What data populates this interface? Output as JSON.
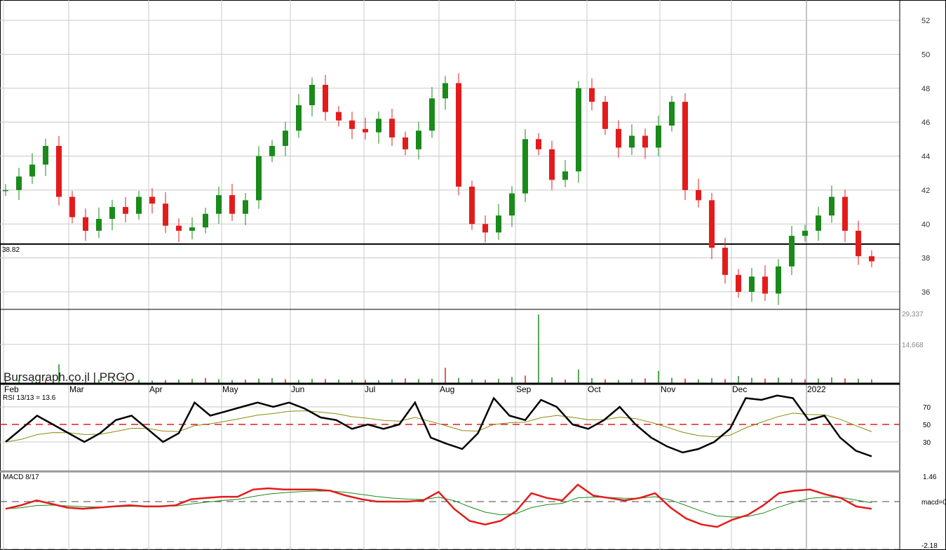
{
  "chart_data": {
    "type": "candlestick",
    "brand": "Bursagraph.co.il | PRGO",
    "ticker": "PRGO",
    "months": [
      "Feb",
      "Mar",
      "Apr",
      "May",
      "Jun",
      "Jul",
      "Aug",
      "Sep",
      "Oct",
      "Nov",
      "Dec",
      "2022"
    ],
    "price": {
      "ylim": [
        35,
        53
      ],
      "ticks": [
        "36",
        "38",
        "40",
        "42",
        "44",
        "46",
        "48",
        "50",
        "52"
      ],
      "reference_line": {
        "value": 38.82,
        "label": "38.82"
      },
      "up_color": "#1a8a1a",
      "down_color": "#e41b1b",
      "closes": [
        42,
        42.8,
        43.5,
        44.6,
        41.6,
        40.4,
        39.6,
        40.3,
        41,
        40.6,
        41.6,
        41.2,
        39.9,
        39.6,
        39.8,
        40.6,
        41.7,
        40.6,
        41.4,
        44,
        44.6,
        45.5,
        47,
        48.2,
        46.6,
        46.1,
        45.6,
        45.4,
        46.2,
        45.1,
        44.4,
        45.5,
        47.4,
        48.3,
        42.2,
        40,
        39.5,
        40.5,
        41.8,
        45,
        44.4,
        42.6,
        43.1,
        48,
        47.2,
        45.6,
        44.5,
        45.2,
        44.5,
        45.8,
        47.2,
        42,
        41.4,
        38.6,
        37,
        36,
        36.9,
        35.9,
        37.5,
        39.3,
        39.6,
        40.5,
        41.6,
        39.6,
        38.1,
        37.8
      ]
    },
    "volume": {
      "ticks": [
        "29,337",
        "14,668"
      ],
      "max": 33000,
      "values": [
        1200,
        1500,
        900,
        1400,
        8000,
        1300,
        1100,
        1600,
        1000,
        1200,
        1400,
        1100,
        1300,
        1500,
        1800,
        2200,
        1700,
        1300,
        1500,
        1900,
        2100,
        1600,
        1400,
        1800,
        1700,
        1500,
        1300,
        1400,
        1200,
        1600,
        2000,
        1700,
        1900,
        6500,
        2200,
        1600,
        1400,
        1800,
        2600,
        3200,
        29337,
        2400,
        1500,
        5800,
        2100,
        1600,
        1400,
        1700,
        2000,
        5200,
        2200,
        1800,
        1600,
        2100,
        1700,
        3000,
        2200,
        1900,
        2300,
        1800,
        1600,
        1900,
        2400,
        2000,
        1800,
        1600
      ]
    },
    "rsi": {
      "label": "RSI 13/13 = 13.6",
      "ticks": [
        "70",
        "50",
        "30"
      ],
      "ylim": [
        10,
        90
      ],
      "values": [
        30,
        45,
        60,
        50,
        40,
        30,
        40,
        55,
        60,
        45,
        30,
        40,
        75,
        60,
        65,
        70,
        75,
        70,
        75,
        68,
        58,
        55,
        45,
        50,
        45,
        50,
        75,
        35,
        28,
        22,
        40,
        80,
        60,
        55,
        78,
        70,
        50,
        45,
        55,
        70,
        50,
        35,
        25,
        18,
        22,
        30,
        45,
        80,
        78,
        83,
        80,
        55,
        60,
        35,
        20,
        13.6
      ]
    },
    "macd": {
      "label": "MACD 8/17",
      "ticks": [
        "1.46",
        "macd=0",
        "-2.18"
      ],
      "ylim": [
        -2.18,
        1.46
      ],
      "values": [
        -0.6,
        -0.3,
        0.1,
        -0.2,
        -0.5,
        -0.6,
        -0.5,
        -0.4,
        -0.3,
        -0.4,
        -0.4,
        -0.3,
        0.2,
        0.3,
        0.4,
        0.4,
        1,
        1.1,
        1,
        1,
        1,
        0.9,
        0.5,
        0.2,
        0,
        0,
        0,
        0.1,
        0.8,
        -0.6,
        -1.6,
        -1.9,
        -1.6,
        -0.8,
        0.7,
        0.3,
        0.1,
        1.4,
        0.5,
        0.3,
        0.1,
        0.3,
        0.7,
        -0.5,
        -1.4,
        -1.9,
        -2.1,
        -1.5,
        -1.1,
        -0.3,
        0.7,
        0.9,
        1.0,
        0.6,
        0.3,
        -0.4,
        -0.6
      ]
    }
  }
}
